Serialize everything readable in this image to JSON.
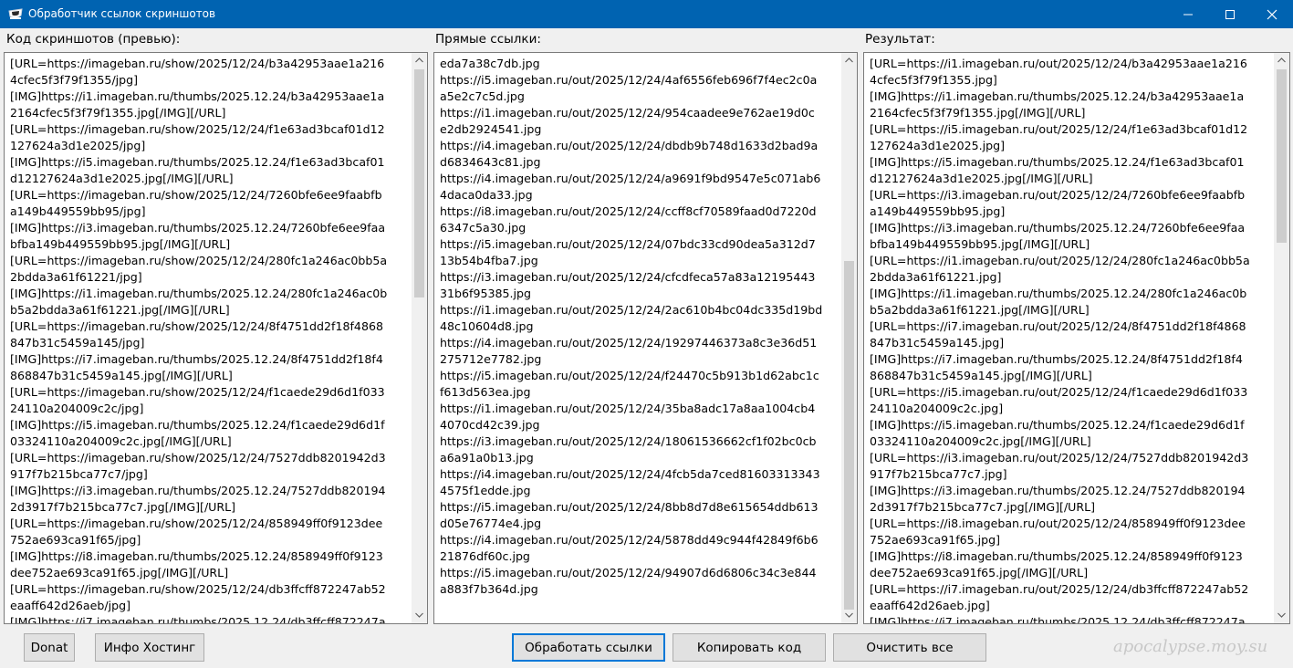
{
  "window": {
    "title": "Обработчик ссылок скриншотов",
    "controls": {
      "minimize_icon": "minimize-icon",
      "maximize_icon": "maximize-icon",
      "close_icon": "close-icon"
    }
  },
  "labels": {
    "preview": "Код скриншотов (превью):",
    "direct": "Прямые ссылки:",
    "result": "Результат:"
  },
  "panels": {
    "preview": [
      "[URL=https://imageban.ru/show/2025/12/24/b3a42953aae1a216",
      "4cfec5f3f79f1355/jpg]",
      "[IMG]https://i1.imageban.ru/thumbs/2025.12.24/b3a42953aae1a",
      "2164cfec5f3f79f1355.jpg[/IMG][/URL]",
      "[URL=https://imageban.ru/show/2025/12/24/f1e63ad3bcaf01d12",
      "127624a3d1e2025/jpg]",
      "[IMG]https://i5.imageban.ru/thumbs/2025.12.24/f1e63ad3bcaf01",
      "d12127624a3d1e2025.jpg[/IMG][/URL]",
      "[URL=https://imageban.ru/show/2025/12/24/7260bfe6ee9faabfb",
      "a149b449559bb95/jpg]",
      "[IMG]https://i3.imageban.ru/thumbs/2025.12.24/7260bfe6ee9faa",
      "bfba149b449559bb95.jpg[/IMG][/URL]",
      "[URL=https://imageban.ru/show/2025/12/24/280fc1a246ac0bb5a",
      "2bdda3a61f61221/jpg]",
      "[IMG]https://i1.imageban.ru/thumbs/2025.12.24/280fc1a246ac0b",
      "b5a2bdda3a61f61221.jpg[/IMG][/URL]",
      "[URL=https://imageban.ru/show/2025/12/24/8f4751dd2f18f4868",
      "847b31c5459a145/jpg]",
      "[IMG]https://i7.imageban.ru/thumbs/2025.12.24/8f4751dd2f18f4",
      "868847b31c5459a145.jpg[/IMG][/URL]",
      "[URL=https://imageban.ru/show/2025/12/24/f1caede29d6d1f033",
      "24110a204009c2c/jpg]",
      "[IMG]https://i5.imageban.ru/thumbs/2025.12.24/f1caede29d6d1f",
      "03324110a204009c2c.jpg[/IMG][/URL]",
      "[URL=https://imageban.ru/show/2025/12/24/7527ddb8201942d3",
      "917f7b215bca77c7/jpg]",
      "[IMG]https://i3.imageban.ru/thumbs/2025.12.24/7527ddb820194",
      "2d3917f7b215bca77c7.jpg[/IMG][/URL]",
      "[URL=https://imageban.ru/show/2025/12/24/858949ff0f9123dee",
      "752ae693ca91f65/jpg]",
      "[IMG]https://i8.imageban.ru/thumbs/2025.12.24/858949ff0f9123",
      "dee752ae693ca91f65.jpg[/IMG][/URL]",
      "[URL=https://imageban.ru/show/2025/12/24/db3ffcff872247ab52",
      "eaaff642d26aeb/jpg]",
      "[IMG]https://i7.imageban.ru/thumbs/2025.12.24/db3ffcff872247a"
    ],
    "direct": [
      "eda7a38c7db.jpg",
      "https://i5.imageban.ru/out/2025/12/24/4af6556feb696f7f4ec2c0a",
      "a5e2c7c5d.jpg",
      "https://i1.imageban.ru/out/2025/12/24/954caadee9e762ae19d0c",
      "e2db2924541.jpg",
      "https://i4.imageban.ru/out/2025/12/24/dbdb9b748d1633d2bad9a",
      "d6834643c81.jpg",
      "https://i4.imageban.ru/out/2025/12/24/a9691f9bd9547e5c071ab6",
      "4daca0da33.jpg",
      "https://i8.imageban.ru/out/2025/12/24/ccff8cf70589faad0d7220d",
      "6347c5a30.jpg",
      "https://i5.imageban.ru/out/2025/12/24/07bdc33cd90dea5a312d7",
      "13b54b4fba7.jpg",
      "https://i3.imageban.ru/out/2025/12/24/cfcdfeca57a83a12195443",
      "31b6f95385.jpg",
      "https://i1.imageban.ru/out/2025/12/24/2ac610b4bc04dc335d19bd",
      "48c10604d8.jpg",
      "https://i4.imageban.ru/out/2025/12/24/19297446373a8c3e36d51",
      "275712e7782.jpg",
      "https://i5.imageban.ru/out/2025/12/24/f24470c5b913b1d62abc1c",
      "f613d563ea.jpg",
      "https://i1.imageban.ru/out/2025/12/24/35ba8adc17a8aa1004cb4",
      "4070cd42c39.jpg",
      "https://i3.imageban.ru/out/2025/12/24/18061536662cf1f02bc0cb",
      "a6a91a0b13.jpg",
      "https://i4.imageban.ru/out/2025/12/24/4fcb5da7ced81603313343",
      "4575f1edde.jpg",
      "https://i5.imageban.ru/out/2025/12/24/8bb8d7d8e615654ddb613",
      "d05e76774e4.jpg",
      "https://i4.imageban.ru/out/2025/12/24/5878dd49c944f42849f6b6",
      "21876df60c.jpg",
      "https://i5.imageban.ru/out/2025/12/24/94907d6d6806c34c3e844",
      "a883f7b364d.jpg"
    ],
    "result": [
      "[URL=https://i1.imageban.ru/out/2025/12/24/b3a42953aae1a216",
      "4cfec5f3f79f1355.jpg]",
      "[IMG]https://i1.imageban.ru/thumbs/2025.12.24/b3a42953aae1a",
      "2164cfec5f3f79f1355.jpg[/IMG][/URL]",
      "[URL=https://i5.imageban.ru/out/2025/12/24/f1e63ad3bcaf01d12",
      "127624a3d1e2025.jpg]",
      "[IMG]https://i5.imageban.ru/thumbs/2025.12.24/f1e63ad3bcaf01",
      "d12127624a3d1e2025.jpg[/IMG][/URL]",
      "[URL=https://i3.imageban.ru/out/2025/12/24/7260bfe6ee9faabfb",
      "a149b449559bb95.jpg]",
      "[IMG]https://i3.imageban.ru/thumbs/2025.12.24/7260bfe6ee9faa",
      "bfba149b449559bb95.jpg[/IMG][/URL]",
      "[URL=https://i1.imageban.ru/out/2025/12/24/280fc1a246ac0bb5a",
      "2bdda3a61f61221.jpg]",
      "[IMG]https://i1.imageban.ru/thumbs/2025.12.24/280fc1a246ac0b",
      "b5a2bdda3a61f61221.jpg[/IMG][/URL]",
      "[URL=https://i7.imageban.ru/out/2025/12/24/8f4751dd2f18f4868",
      "847b31c5459a145.jpg]",
      "[IMG]https://i7.imageban.ru/thumbs/2025.12.24/8f4751dd2f18f4",
      "868847b31c5459a145.jpg[/IMG][/URL]",
      "[URL=https://i5.imageban.ru/out/2025/12/24/f1caede29d6d1f033",
      "24110a204009c2c.jpg]",
      "[IMG]https://i5.imageban.ru/thumbs/2025.12.24/f1caede29d6d1f",
      "03324110a204009c2c.jpg[/IMG][/URL]",
      "[URL=https://i3.imageban.ru/out/2025/12/24/7527ddb8201942d3",
      "917f7b215bca77c7.jpg]",
      "[IMG]https://i3.imageban.ru/thumbs/2025.12.24/7527ddb820194",
      "2d3917f7b215bca77c7.jpg[/IMG][/URL]",
      "[URL=https://i8.imageban.ru/out/2025/12/24/858949ff0f9123dee",
      "752ae693ca91f65.jpg]",
      "[IMG]https://i8.imageban.ru/thumbs/2025.12.24/858949ff0f9123",
      "dee752ae693ca91f65.jpg[/IMG][/URL]",
      "[URL=https://i7.imageban.ru/out/2025/12/24/db3ffcff872247ab52",
      "eaaff642d26aeb.jpg]",
      "[IMG]https://i7.imageban.ru/thumbs/2025.12.24/db3ffcff872247a"
    ]
  },
  "buttons": {
    "donat": "Donat",
    "info": "Инфо Хостинг",
    "process": "Обработать ссылки",
    "copy": "Копировать код",
    "clear": "Очистить все"
  },
  "watermark": "apocalypse.moy.su"
}
